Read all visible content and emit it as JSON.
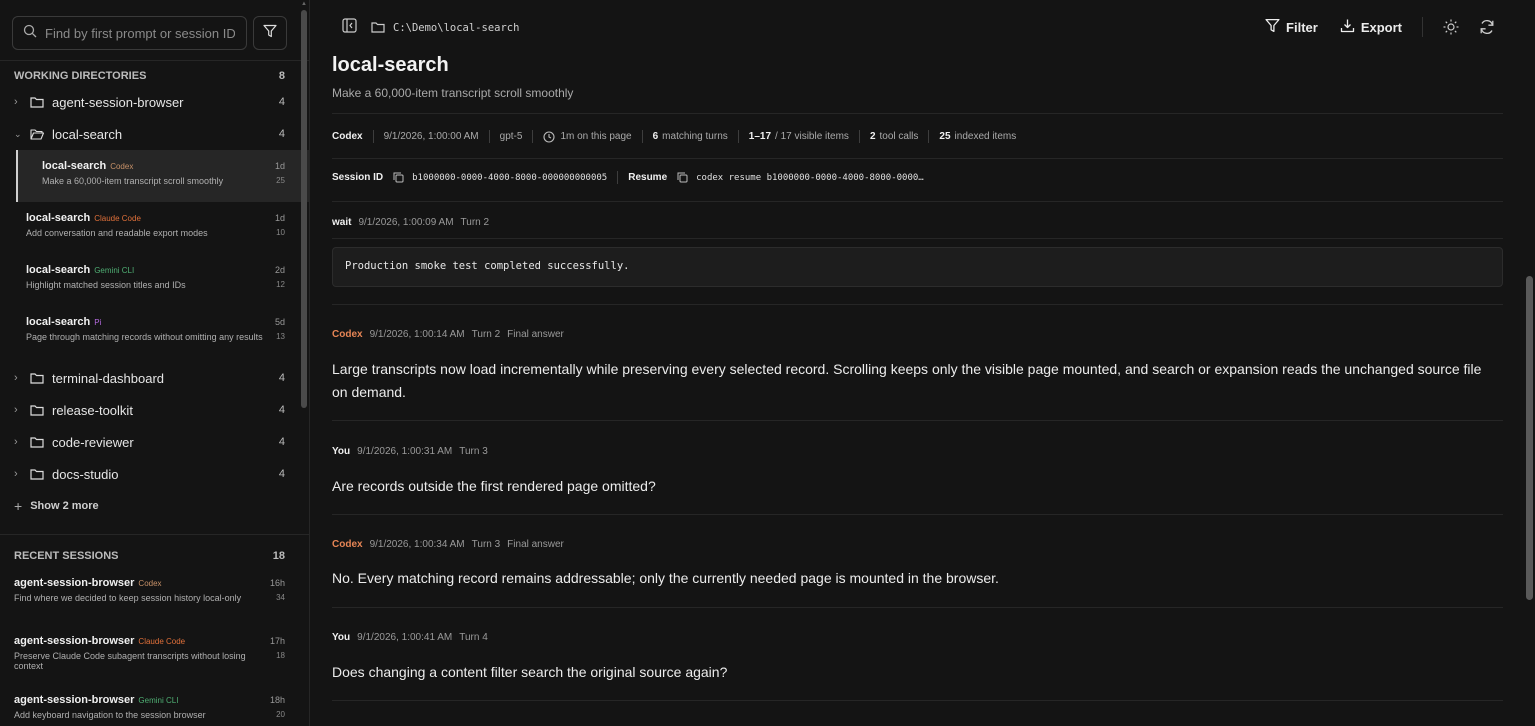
{
  "sidebar": {
    "search_placeholder": "Find by first prompt or session ID",
    "working_dirs_label": "WORKING DIRECTORIES",
    "working_dirs_count": "8",
    "dirs_top": [
      {
        "name": "agent-session-browser",
        "count": "4"
      },
      {
        "name": "local-search",
        "count": "4"
      }
    ],
    "sessions": [
      {
        "title": "local-search",
        "tag": "Codex",
        "desc": "Make a 60,000-item transcript scroll smoothly",
        "age": "1d",
        "n": "25"
      },
      {
        "title": "local-search",
        "tag": "Claude Code",
        "desc": "Add conversation and readable export modes",
        "age": "1d",
        "n": "10"
      },
      {
        "title": "local-search",
        "tag": "Gemini CLI",
        "desc": "Highlight matched session titles and IDs",
        "age": "2d",
        "n": "12"
      },
      {
        "title": "local-search",
        "tag": "Pi",
        "desc": "Page through matching records without omitting any results",
        "age": "5d",
        "n": "13"
      }
    ],
    "dirs_bottom": [
      {
        "name": "terminal-dashboard",
        "count": "4"
      },
      {
        "name": "release-toolkit",
        "count": "4"
      },
      {
        "name": "code-reviewer",
        "count": "4"
      },
      {
        "name": "docs-studio",
        "count": "4"
      }
    ],
    "show_more": "Show 2 more",
    "recent_label": "RECENT SESSIONS",
    "recent_count": "18",
    "recent": [
      {
        "title": "agent-session-browser",
        "tag": "Codex",
        "desc": "Find where we decided to keep session history local-only",
        "age": "16h",
        "n": "34"
      },
      {
        "title": "agent-session-browser",
        "tag": "Claude Code",
        "desc": "Preserve Claude Code subagent transcripts without losing context",
        "age": "17h",
        "n": "18"
      },
      {
        "title": "agent-session-browser",
        "tag": "Gemini CLI",
        "desc": "Add keyboard navigation to the session browser",
        "age": "18h",
        "n": "20"
      }
    ]
  },
  "topbar": {
    "path": "C:\\Demo\\local-search",
    "filter": "Filter",
    "export": "Export"
  },
  "header": {
    "title": "local-search",
    "subtitle": "Make a 60,000-item transcript scroll smoothly"
  },
  "meta": {
    "agent": "Codex",
    "date": "9/1/2026, 1:00:00 AM",
    "model": "gpt-5",
    "time_on_page": "1m on this page",
    "matching_n": "6",
    "matching_label": "matching turns",
    "range": "1–17",
    "range_label": "/ 17 visible items",
    "tool_n": "2",
    "tool_label": "tool calls",
    "indexed_n": "25",
    "indexed_label": "indexed items"
  },
  "session": {
    "id_label": "Session ID",
    "id_value": "b1000000-0000-4000-8000-000000000005",
    "resume_label": "Resume",
    "resume_value": "codex resume b1000000-0000-4000-8000-0000…"
  },
  "messages": [
    {
      "who": "wait",
      "time": "9/1/2026, 1:00:09 AM",
      "turn": "Turn 2",
      "extra": "",
      "code": "Production smoke test completed successfully."
    },
    {
      "who": "Codex",
      "time": "9/1/2026, 1:00:14 AM",
      "turn": "Turn 2",
      "extra": "Final answer",
      "body": "Large transcripts now load incrementally while preserving every selected record. Scrolling keeps only the visible page mounted, and search or expansion reads the unchanged source file on demand."
    },
    {
      "who": "You",
      "time": "9/1/2026, 1:00:31 AM",
      "turn": "Turn 3",
      "extra": "",
      "body": "Are records outside the first rendered page omitted?"
    },
    {
      "who": "Codex",
      "time": "9/1/2026, 1:00:34 AM",
      "turn": "Turn 3",
      "extra": "Final answer",
      "body": "No. Every matching record remains addressable; only the currently needed page is mounted in the browser."
    },
    {
      "who": "You",
      "time": "9/1/2026, 1:00:41 AM",
      "turn": "Turn 4",
      "extra": "",
      "body": "Does changing a content filter search the original source again?"
    }
  ]
}
